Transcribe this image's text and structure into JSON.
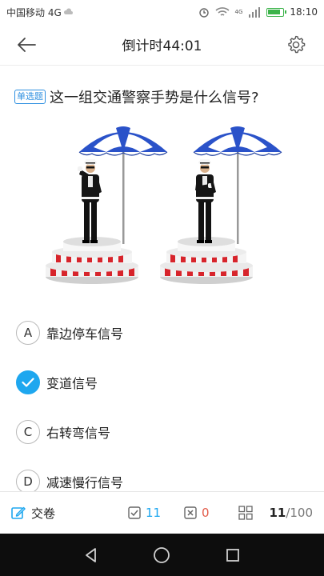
{
  "status_bar": {
    "carrier": "中国移动 4G",
    "network": "4G",
    "time": "18:10"
  },
  "header": {
    "timer": "倒计时44:01",
    "back_icon": "arrow-left-icon",
    "settings_icon": "gear-icon"
  },
  "question": {
    "type_badge": "单选题",
    "text": "这一组交通警察手势是什么信号?"
  },
  "options": [
    {
      "letter": "A",
      "text": "靠边停车信号",
      "selected": false
    },
    {
      "letter": "B",
      "text": "变道信号",
      "selected": true
    },
    {
      "letter": "C",
      "text": "右转弯信号",
      "selected": false
    },
    {
      "letter": "D",
      "text": "减速慢行信号",
      "selected": false
    }
  ],
  "bottom_bar": {
    "submit_label": "交卷",
    "correct_count": "11",
    "wrong_count": "0",
    "progress_current": "11",
    "progress_total": "/100"
  },
  "colors": {
    "accent": "#1ea7ef",
    "wrong": "#e25c4a",
    "umbrella_blue": "#2a52c9",
    "podium_red": "#d7242b"
  }
}
